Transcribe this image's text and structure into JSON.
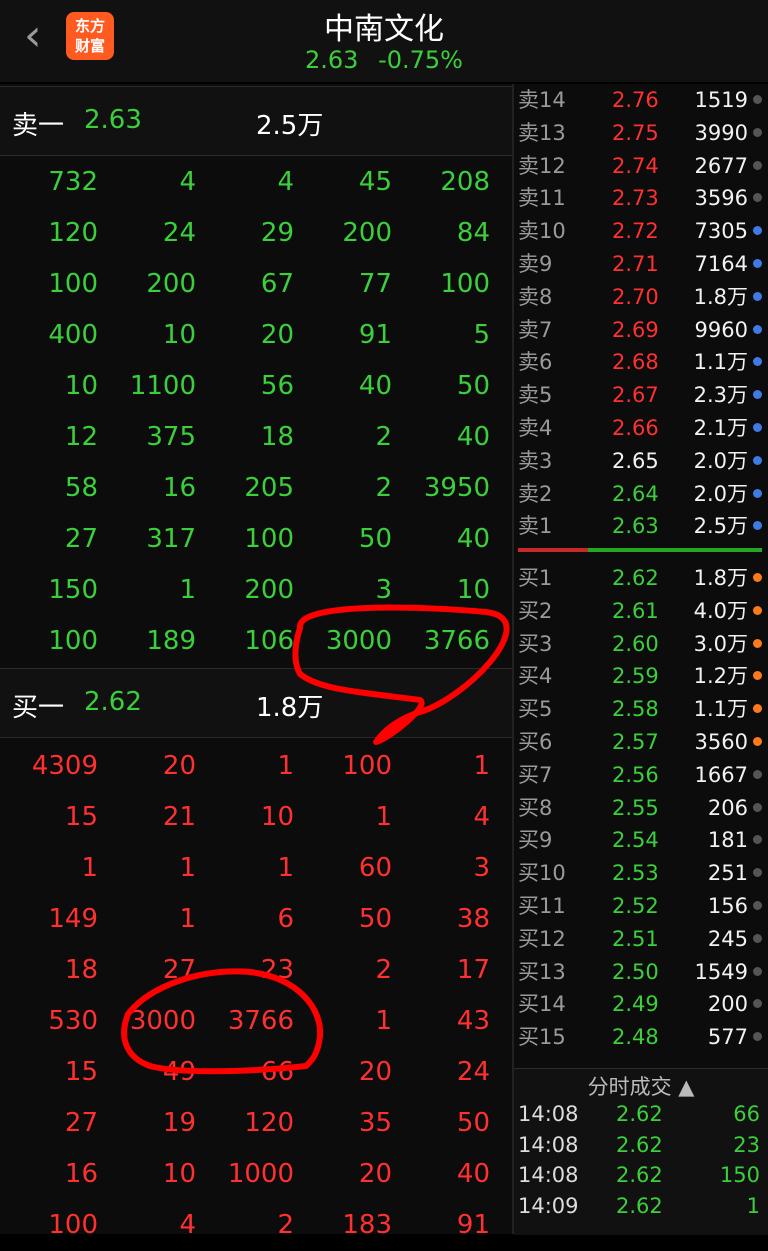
{
  "header": {
    "back_icon": "chevron-left-icon",
    "logo_line1": "东方",
    "logo_line2": "财富",
    "title": "中南文化",
    "price": "2.63",
    "change": "-0.75%"
  },
  "sell_summary": {
    "label": "卖一",
    "price": "2.63",
    "volume": "2.5万"
  },
  "buy_summary": {
    "label": "买一",
    "price": "2.62",
    "volume": "1.8万"
  },
  "sell_queue": [
    [
      "732",
      "4",
      "4",
      "45",
      "208"
    ],
    [
      "120",
      "24",
      "29",
      "200",
      "84"
    ],
    [
      "100",
      "200",
      "67",
      "77",
      "100"
    ],
    [
      "400",
      "10",
      "20",
      "91",
      "5"
    ],
    [
      "10",
      "1100",
      "56",
      "40",
      "50"
    ],
    [
      "12",
      "375",
      "18",
      "2",
      "40"
    ],
    [
      "58",
      "16",
      "205",
      "2",
      "3950"
    ],
    [
      "27",
      "317",
      "100",
      "50",
      "40"
    ],
    [
      "150",
      "1",
      "200",
      "3",
      "10"
    ],
    [
      "100",
      "189",
      "106",
      "3000",
      "3766"
    ]
  ],
  "buy_queue": [
    [
      "4309",
      "20",
      "1",
      "100",
      "1"
    ],
    [
      "15",
      "21",
      "10",
      "1",
      "4"
    ],
    [
      "1",
      "1",
      "1",
      "60",
      "3"
    ],
    [
      "149",
      "1",
      "6",
      "50",
      "38"
    ],
    [
      "18",
      "27",
      "23",
      "2",
      "17"
    ],
    [
      "530",
      "3000",
      "3766",
      "1",
      "43"
    ],
    [
      "15",
      "49",
      "66",
      "20",
      "24"
    ],
    [
      "27",
      "19",
      "120",
      "35",
      "50"
    ],
    [
      "16",
      "10",
      "1000",
      "20",
      "40"
    ],
    [
      "100",
      "4",
      "2",
      "183",
      "91"
    ]
  ],
  "order_book": {
    "asks": [
      {
        "label": "卖14",
        "price": "2.76",
        "vol": "1519",
        "color": "red",
        "dot": "#555"
      },
      {
        "label": "卖13",
        "price": "2.75",
        "vol": "3990",
        "color": "red",
        "dot": "#555"
      },
      {
        "label": "卖12",
        "price": "2.74",
        "vol": "2677",
        "color": "red",
        "dot": "#555"
      },
      {
        "label": "卖11",
        "price": "2.73",
        "vol": "3596",
        "color": "red",
        "dot": "#555"
      },
      {
        "label": "卖10",
        "price": "2.72",
        "vol": "7305",
        "color": "red",
        "dot": "#3f7be6"
      },
      {
        "label": "卖9",
        "price": "2.71",
        "vol": "7164",
        "color": "red",
        "dot": "#3f7be6"
      },
      {
        "label": "卖8",
        "price": "2.70",
        "vol": "1.8万",
        "color": "red",
        "dot": "#3f7be6"
      },
      {
        "label": "卖7",
        "price": "2.69",
        "vol": "9960",
        "color": "red",
        "dot": "#3f7be6"
      },
      {
        "label": "卖6",
        "price": "2.68",
        "vol": "1.1万",
        "color": "red",
        "dot": "#3f7be6"
      },
      {
        "label": "卖5",
        "price": "2.67",
        "vol": "2.3万",
        "color": "red",
        "dot": "#3f7be6"
      },
      {
        "label": "卖4",
        "price": "2.66",
        "vol": "2.1万",
        "color": "red",
        "dot": "#3f7be6"
      },
      {
        "label": "卖3",
        "price": "2.65",
        "vol": "2.0万",
        "color": "white",
        "dot": "#3f7be6"
      },
      {
        "label": "卖2",
        "price": "2.64",
        "vol": "2.0万",
        "color": "green",
        "dot": "#3f7be6"
      },
      {
        "label": "卖1",
        "price": "2.63",
        "vol": "2.5万",
        "color": "green",
        "dot": "#3f7be6"
      }
    ],
    "bids": [
      {
        "label": "买1",
        "price": "2.62",
        "vol": "1.8万",
        "color": "green",
        "dot": "#ff7a1a"
      },
      {
        "label": "买2",
        "price": "2.61",
        "vol": "4.0万",
        "color": "green",
        "dot": "#ff7a1a"
      },
      {
        "label": "买3",
        "price": "2.60",
        "vol": "3.0万",
        "color": "green",
        "dot": "#ff7a1a"
      },
      {
        "label": "买4",
        "price": "2.59",
        "vol": "1.2万",
        "color": "green",
        "dot": "#ff7a1a"
      },
      {
        "label": "买5",
        "price": "2.58",
        "vol": "1.1万",
        "color": "green",
        "dot": "#ff7a1a"
      },
      {
        "label": "买6",
        "price": "2.57",
        "vol": "3560",
        "color": "green",
        "dot": "#ff7a1a"
      },
      {
        "label": "买7",
        "price": "2.56",
        "vol": "1667",
        "color": "green",
        "dot": "#555"
      },
      {
        "label": "买8",
        "price": "2.55",
        "vol": "206",
        "color": "green",
        "dot": "#555"
      },
      {
        "label": "买9",
        "price": "2.54",
        "vol": "181",
        "color": "green",
        "dot": "#555"
      },
      {
        "label": "买10",
        "price": "2.53",
        "vol": "251",
        "color": "green",
        "dot": "#555"
      },
      {
        "label": "买11",
        "price": "2.52",
        "vol": "156",
        "color": "green",
        "dot": "#555"
      },
      {
        "label": "买12",
        "price": "2.51",
        "vol": "245",
        "color": "green",
        "dot": "#555"
      },
      {
        "label": "买13",
        "price": "2.50",
        "vol": "1549",
        "color": "green",
        "dot": "#555"
      },
      {
        "label": "买14",
        "price": "2.49",
        "vol": "200",
        "color": "green",
        "dot": "#555"
      },
      {
        "label": "买15",
        "price": "2.48",
        "vol": "577",
        "color": "green",
        "dot": "#555"
      }
    ]
  },
  "ticks": {
    "header": "分时成交 ▲",
    "rows": [
      {
        "time": "14:08",
        "price": "2.62",
        "vol": "66"
      },
      {
        "time": "14:08",
        "price": "2.62",
        "vol": "23"
      },
      {
        "time": "14:08",
        "price": "2.62",
        "vol": "150"
      },
      {
        "time": "14:09",
        "price": "2.62",
        "vol": "1"
      }
    ]
  },
  "colors": {
    "green": "#3ccf3c",
    "red": "#ff3030",
    "annotation": "#ff0000"
  }
}
